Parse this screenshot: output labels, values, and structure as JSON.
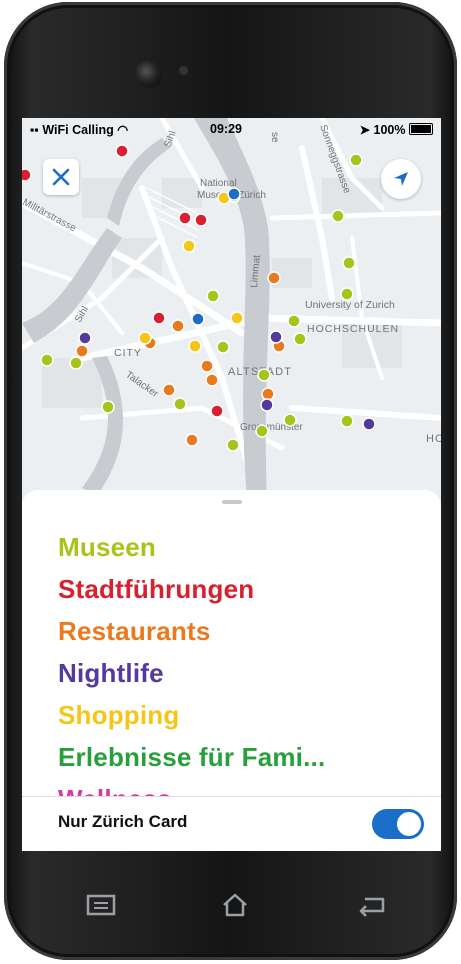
{
  "status_bar": {
    "carrier": "WiFi Calling",
    "time": "09:29",
    "battery": "100%"
  },
  "map": {
    "labels": {
      "museum": "National Museum Zürich",
      "museum_line1": "National",
      "museum_line2": "Museum Zürich",
      "militaerstrasse": "Militärstrasse",
      "sihl_upper": "Sihl",
      "sihl_lower": "Sihl",
      "limmat": "Limmat",
      "university": "University of Zurich",
      "hochschulen": "HOCHSCHULEN",
      "city": "CITY",
      "altstadt": "ALTSTADT",
      "talacker": "Talacker",
      "grossmuenster": "Grossmünster",
      "sonneggstrasse": "Sonneggstrasse",
      "hc": "HC",
      "se": "se"
    },
    "close_icon": "close-icon",
    "locate_icon": "navigation-arrow-icon"
  },
  "categories": [
    {
      "label": "Museen",
      "color": "#a8c41a"
    },
    {
      "label": "Stadtführungen",
      "color": "#d8202e"
    },
    {
      "label": "Restaurants",
      "color": "#ea7a1e"
    },
    {
      "label": "Nightlife",
      "color": "#553a9e"
    },
    {
      "label": "Shopping",
      "color": "#f5c518"
    },
    {
      "label": "Erlebnisse für Fami...",
      "color": "#27a03c"
    },
    {
      "label": "Wellness",
      "color": "#d43aa3"
    }
  ],
  "filter": {
    "label": "Nur Zürich Card",
    "enabled": true,
    "accent": "#1a6ec8"
  },
  "softkeys": {
    "menu": "menu-icon",
    "home": "home-icon",
    "back": "back-icon"
  }
}
